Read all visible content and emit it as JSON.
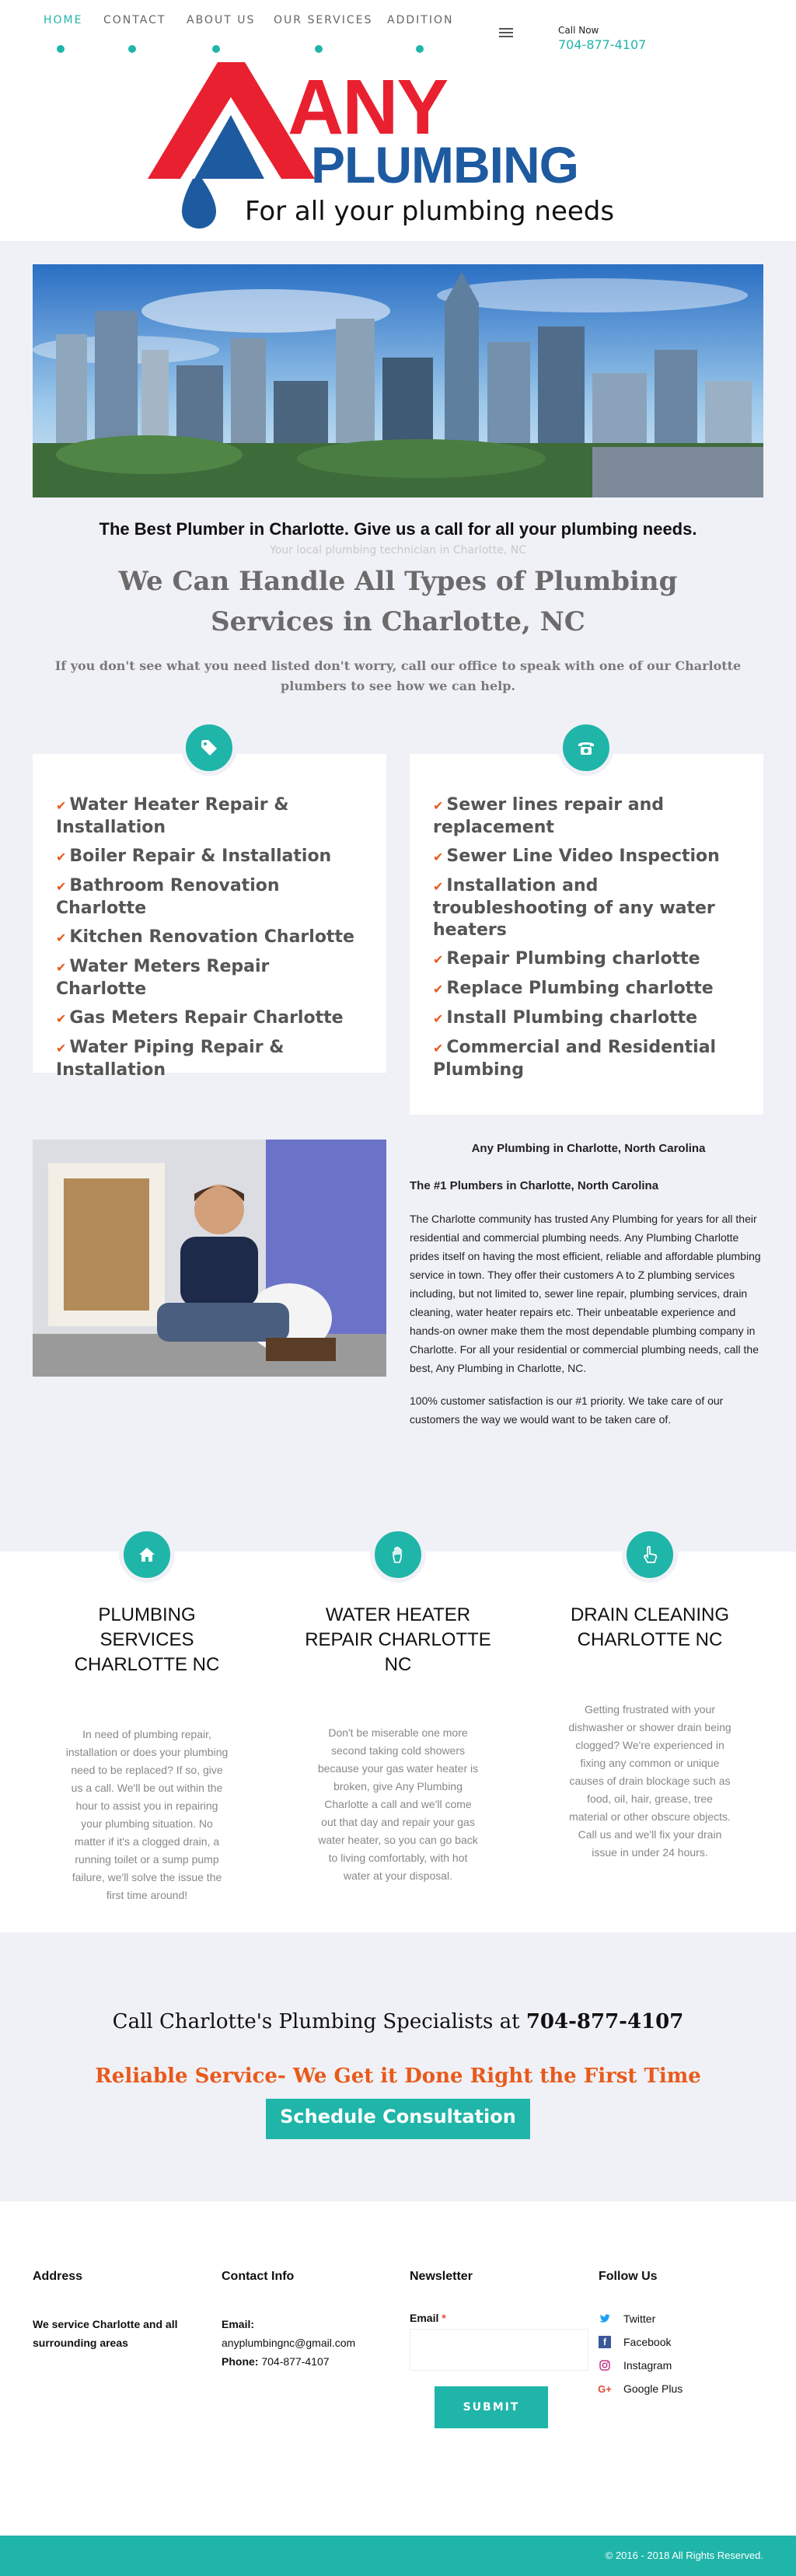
{
  "nav": {
    "items": [
      {
        "label": "HOME",
        "active": true
      },
      {
        "label": "CONTACT",
        "active": false
      },
      {
        "label": "ABOUT US",
        "active": false
      },
      {
        "label": "OUR SERVICES",
        "active": false
      },
      {
        "label": "ADDITION",
        "active": false
      }
    ],
    "menu_icon": "hamburger-icon",
    "call_label": "Call Now",
    "call_number": "704-877-4107"
  },
  "logo": {
    "word1": "ANY",
    "word2": "PLUMBING",
    "slogan": "For all your plumbing needs",
    "colors": {
      "red": "#e8202f",
      "blue": "#1e5aa0"
    }
  },
  "intro": {
    "tagline": "The Best Plumber in Charlotte. Give us a call for all your plumbing needs.",
    "subtag": "Your local plumbing technician in Charlotte, NC",
    "headline": "We Can Handle All Types of Plumbing Services in Charlotte, NC",
    "subhead": "If you don't see what you need listed don't worry, call our office to speak with one of our Charlotte plumbers to see how we can help."
  },
  "services_left": {
    "icon": "tag-icon",
    "items": [
      "Water Heater Repair & Installation",
      "Boiler Repair & Installation",
      "Bathroom Renovation Charlotte",
      "Kitchen Renovation Charlotte",
      "Water Meters Repair Charlotte",
      "Gas Meters Repair Charlotte",
      "Water Piping Repair & Installation"
    ]
  },
  "services_right": {
    "icon": "phone-icon",
    "items": [
      "Sewer lines repair and replacement",
      "Sewer Line Video Inspection",
      "Installation and troubleshooting of any water heaters",
      "Repair Plumbing charlotte",
      "Replace Plumbing charlotte",
      "Install Plumbing charlotte",
      "Commercial and Residential Plumbing"
    ]
  },
  "about": {
    "title": "Any Plumbing in Charlotte, North Carolina",
    "subtitle": "The #1 Plumbers in Charlotte, North Carolina",
    "paragraph1": "The Charlotte community has trusted Any Plumbing for years for all their residential and commercial plumbing needs. Any Plumbing Charlotte prides itself on having the most efficient, reliable and affordable plumbing service in town. They offer their customers A to Z plumbing services including, but not limited to, sewer line repair, plumbing services, drain cleaning, water heater repairs etc. Their unbeatable experience and hands-on owner make them the most dependable plumbing company in Charlotte. For all your residential or commercial plumbing needs, call the best, Any Plumbing in Charlotte, NC.",
    "paragraph2": "100% customer satisfaction is our #1 priority. We take care of our customers the way we would want to be taken care of."
  },
  "features": [
    {
      "icon": "home-icon",
      "title": "PLUMBING SERVICES CHARLOTTE NC",
      "text": "In need of plumbing repair, installation or does your plumbing need to be replaced? If so, give us a call. We'll be out within the hour to assist you in repairing your plumbing situation. No matter if it's a clogged drain, a running toilet or a sump pump failure, we'll solve the issue the first time around!"
    },
    {
      "icon": "hand-icon",
      "title": "WATER HEATER REPAIR CHARLOTTE NC",
      "text": "Don't be miserable one more second taking cold showers because your gas water heater is broken, give Any Plumbing Charlotte a call and we'll come out that day and repair your gas water heater, so you can go back to living comfortably, with hot water at your disposal."
    },
    {
      "icon": "pointer-icon",
      "title": "DRAIN CLEANING CHARLOTTE NC",
      "text": "Getting frustrated with your dishwasher or shower drain being clogged? We're experienced in fixing any common or unique causes of drain blockage such as food, oil, hair, grease, tree material or other obscure objects. Call us and we'll fix your drain issue in under 24 hours."
    }
  ],
  "cta": {
    "line_prefix": "Call Charlotte's Plumbing Specialists at",
    "line_number": "704-877-4107",
    "reliable": "Reliable Service- We Get it Done Right the First Time",
    "button": "Schedule Consultation"
  },
  "footer": {
    "address": {
      "heading": "Address",
      "text": "We service Charlotte and all surrounding areas"
    },
    "contact": {
      "heading": "Contact Info",
      "email_label": "Email",
      "email": "anyplumbingnc@gmail.com",
      "phone_label": "Phone",
      "phone": "704-877-4107"
    },
    "newsletter": {
      "heading": "Newsletter",
      "email_label": "Email",
      "required": "*",
      "placeholder": "",
      "submit": "SUBMIT"
    },
    "follow": {
      "heading": "Follow Us",
      "links": [
        {
          "label": "Twitter",
          "icon": "twitter-icon",
          "color": "#1da1f2"
        },
        {
          "label": "Facebook",
          "icon": "facebook-icon",
          "color": "#3b5998"
        },
        {
          "label": "Instagram",
          "icon": "instagram-icon",
          "color": "#c13584"
        },
        {
          "label": "Google Plus",
          "icon": "google-plus-icon",
          "color": "#dd4b39"
        }
      ]
    },
    "copyright": "© 2016 - 2018 All Rights Reserved."
  },
  "colors": {
    "accent": "#20b5a9",
    "orange": "#e85a1b",
    "grey_bg": "#f0f1f6"
  }
}
